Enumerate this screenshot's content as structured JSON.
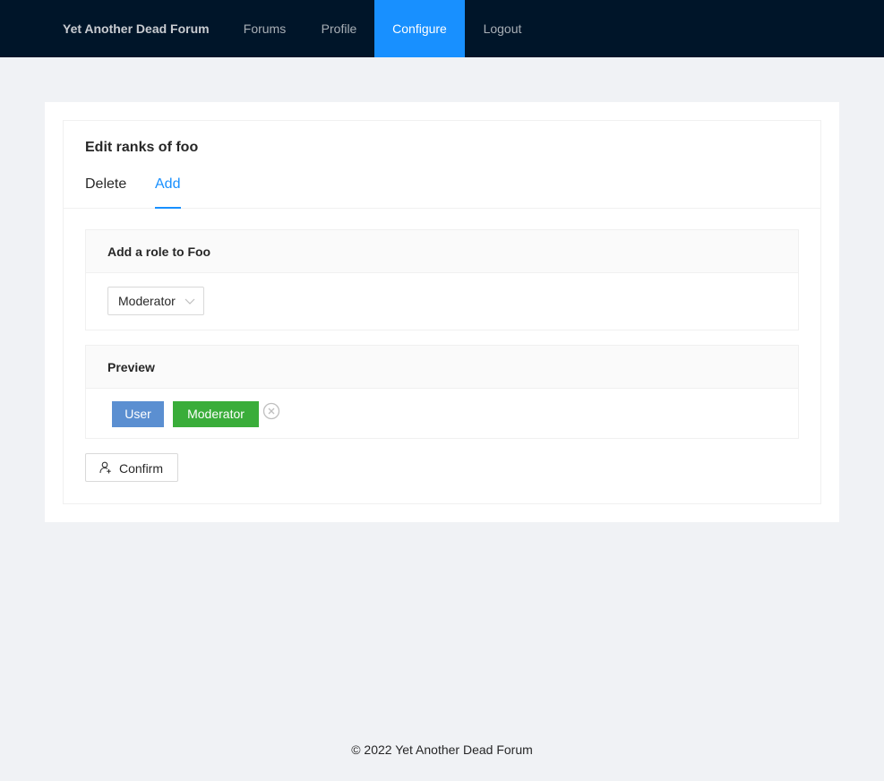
{
  "header": {
    "brand": "Yet Another Dead Forum",
    "nav": [
      {
        "label": "Forums"
      },
      {
        "label": "Profile"
      },
      {
        "label": "Configure"
      },
      {
        "label": "Logout"
      }
    ]
  },
  "card": {
    "title": "Edit ranks of foo",
    "tabs": [
      {
        "label": "Delete"
      },
      {
        "label": "Add"
      }
    ]
  },
  "add_role": {
    "title": "Add a role to Foo",
    "select_value": "Moderator"
  },
  "preview": {
    "title": "Preview",
    "tags": [
      {
        "label": "User",
        "color": "#5b8fd1"
      },
      {
        "label": "Moderator",
        "color": "#3aad3a"
      }
    ]
  },
  "confirm_label": "Confirm",
  "footer": "© 2022 Yet Another Dead Forum",
  "colors": {
    "header_bg": "#001529",
    "accent": "#1890ff"
  }
}
